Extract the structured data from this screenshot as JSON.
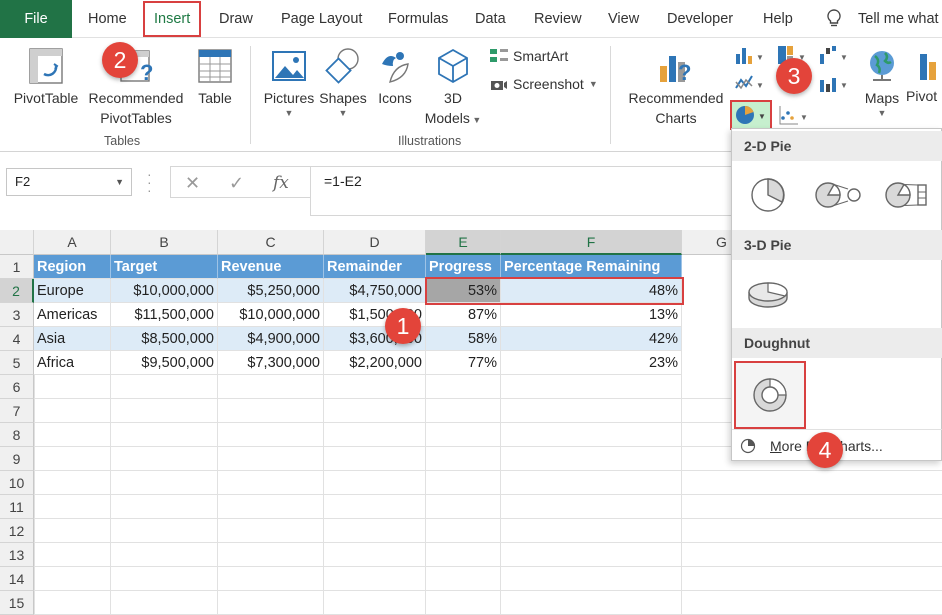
{
  "tabs": [
    "File",
    "Home",
    "Insert",
    "Draw",
    "Page Layout",
    "Formulas",
    "Data",
    "Review",
    "View",
    "Developer",
    "Help"
  ],
  "tellme": "Tell me what",
  "ribbon": {
    "pivottable": "PivotTable",
    "rec_pivot": [
      "Recommended",
      "PivotTables"
    ],
    "table": "Table",
    "tables_group": "Tables",
    "pictures": "Pictures",
    "shapes": "Shapes",
    "icons": "Icons",
    "models": [
      "3D",
      "Models"
    ],
    "smartart": "SmartArt",
    "screenshot": "Screenshot",
    "illustrations_group": "Illustrations",
    "rec_charts": [
      "Recommended",
      "Charts"
    ],
    "maps": "Maps",
    "pivot_chart": "Pivot"
  },
  "formula": {
    "namebox": "F2",
    "fx": "fx",
    "value": "=1-E2"
  },
  "columns": [
    "A",
    "B",
    "C",
    "D",
    "E",
    "F",
    "G"
  ],
  "rows": [
    "1",
    "2",
    "3",
    "4",
    "5",
    "6",
    "7",
    "8",
    "9",
    "10",
    "11",
    "12",
    "13",
    "14",
    "15"
  ],
  "table": {
    "headers": [
      "Region",
      "Target",
      "Revenue",
      "Remainder",
      "Progress",
      "Percentage Remaining"
    ],
    "data": [
      [
        "Europe",
        "$10,000,000",
        "$5,250,000",
        "$4,750,000",
        "53%",
        "48%"
      ],
      [
        "Americas",
        "$11,500,000",
        "$10,000,000",
        "$1,500,000",
        "87%",
        "13%"
      ],
      [
        "Asia",
        "$8,500,000",
        "$4,900,000",
        "$3,600,000",
        "58%",
        "42%"
      ],
      [
        "Africa",
        "$9,500,000",
        "$7,300,000",
        "$2,200,000",
        "77%",
        "23%"
      ]
    ]
  },
  "dropdown": {
    "pie2d": "2-D Pie",
    "pie3d": "3-D Pie",
    "doughnut": "Doughnut",
    "more_prefix": "M",
    "more": "ore Pie Charts..."
  },
  "callouts": [
    "1",
    "2",
    "3",
    "4"
  ],
  "colors": {
    "excel_green": "#217346",
    "header_blue": "#5b9bd5",
    "band_blue": "#ddebf7",
    "callout_red": "#e3443a"
  }
}
